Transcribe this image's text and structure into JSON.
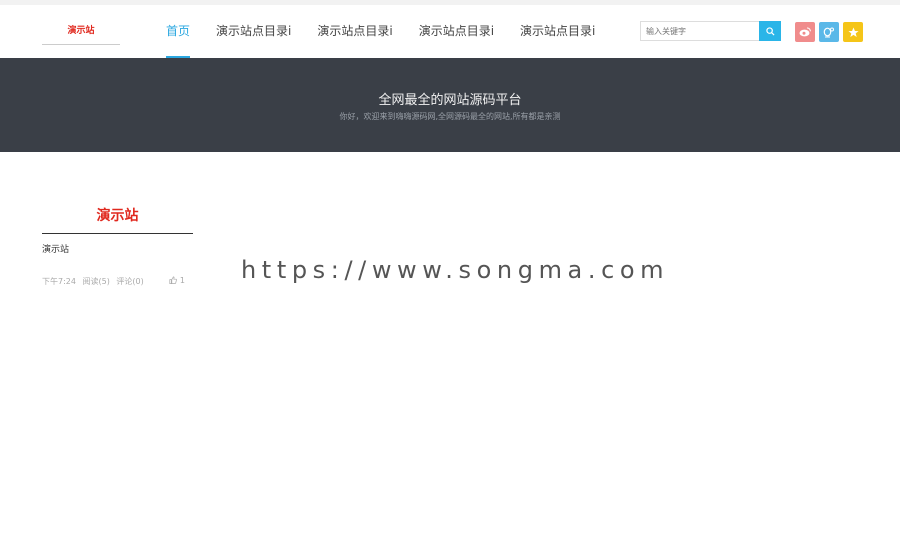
{
  "header": {
    "logo_text": "演示站",
    "nav": [
      {
        "label": "首页",
        "active": true
      },
      {
        "label": "演示站点目录i",
        "active": false
      },
      {
        "label": "演示站点目录i",
        "active": false
      },
      {
        "label": "演示站点目录i",
        "active": false
      },
      {
        "label": "演示站点目录i",
        "active": false
      }
    ],
    "search_placeholder": "输入关键字",
    "social": [
      {
        "icon": "weibo-icon",
        "color": "#f08c8c"
      },
      {
        "icon": "qq-icon",
        "color": "#5ab8e8"
      },
      {
        "icon": "star-icon",
        "color": "#f5c518"
      }
    ]
  },
  "banner": {
    "title": "全网最全的网站源码平台",
    "subtitle": "你好，欢迎来到嗨嗨源码网,全网源码最全的网站,所有都是亲测"
  },
  "post": {
    "thumb_text": "演示站",
    "title": "演示站",
    "time": "下午7:24",
    "views": "阅读(5)",
    "comments": "评论(0)",
    "likes": "1"
  },
  "watermark": "https://www.songma.com",
  "colors": {
    "accent": "#2aa7e0",
    "banner_bg": "#3a3f47",
    "logo_red": "#e0281e"
  }
}
